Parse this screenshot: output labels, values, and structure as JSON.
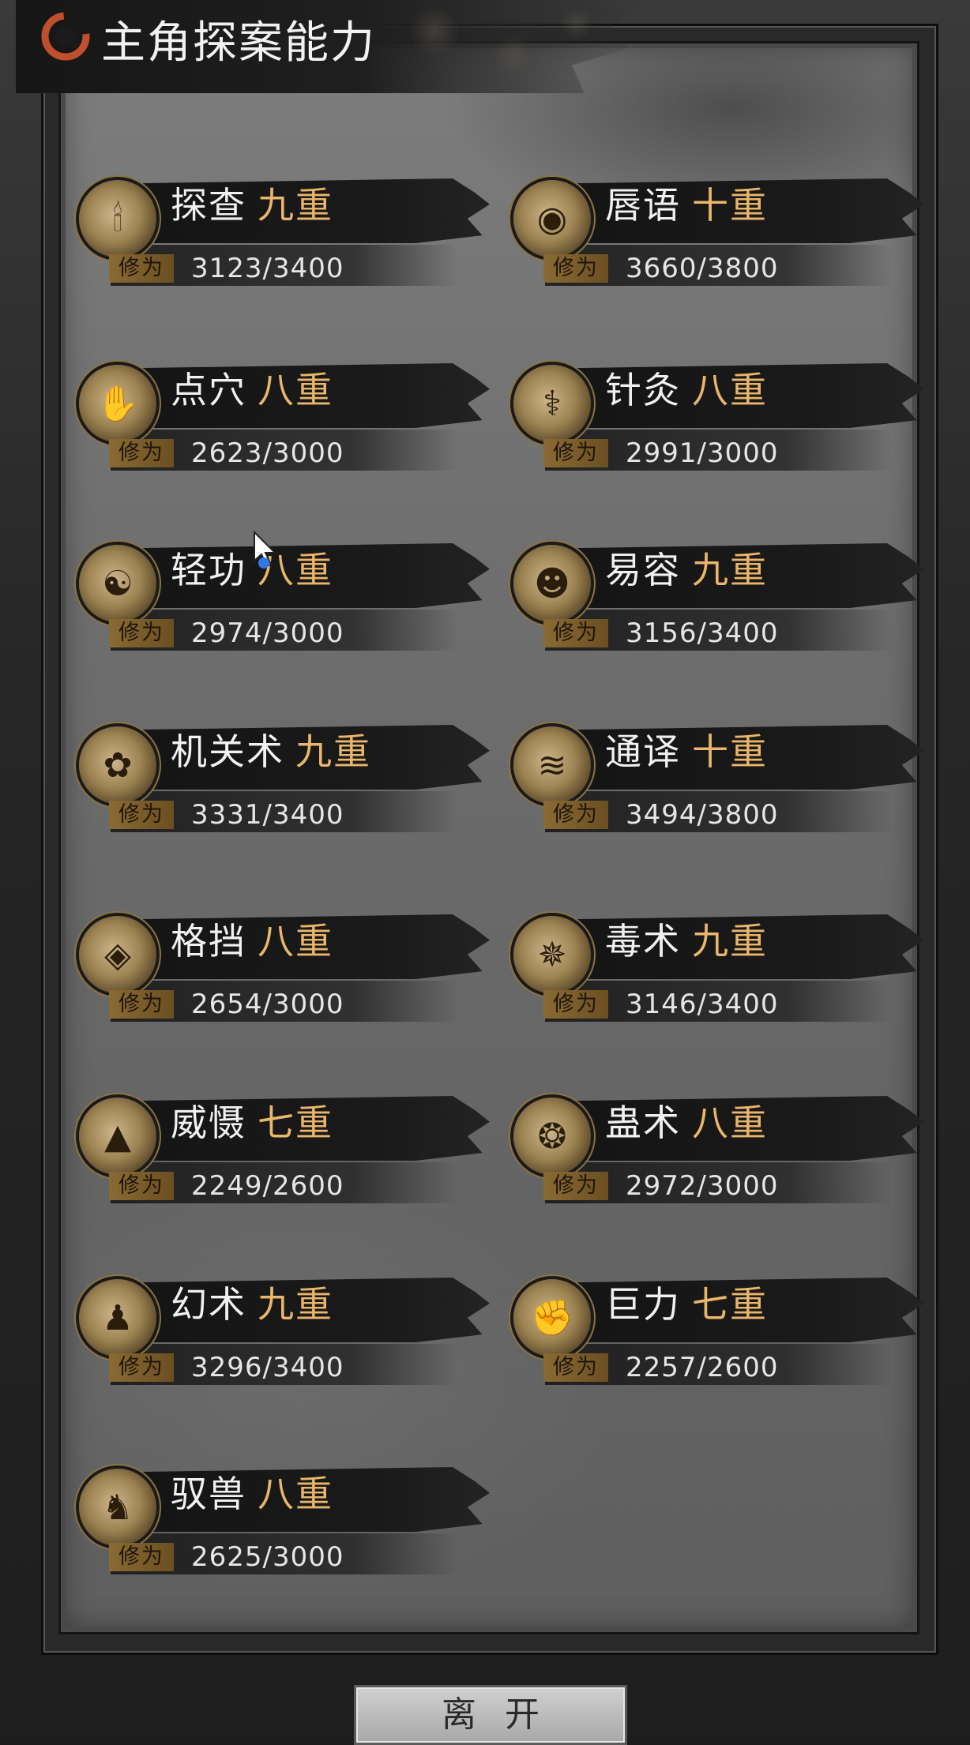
{
  "header": {
    "title": "主角探案能力"
  },
  "xp_label": "修为",
  "skills": [
    {
      "name": "探查",
      "rank": "九重",
      "xp": "3123/3400",
      "icon": "candle-icon"
    },
    {
      "name": "唇语",
      "rank": "十重",
      "xp": "3660/3800",
      "icon": "lips-icon"
    },
    {
      "name": "点穴",
      "rank": "八重",
      "xp": "2623/3000",
      "icon": "hand-icon"
    },
    {
      "name": "针灸",
      "rank": "八重",
      "xp": "2991/3000",
      "icon": "needle-icon"
    },
    {
      "name": "轻功",
      "rank": "八重",
      "xp": "2974/3000",
      "icon": "flying-figure-icon"
    },
    {
      "name": "易容",
      "rank": "九重",
      "xp": "3156/3400",
      "icon": "mask-icon"
    },
    {
      "name": "机关术",
      "rank": "九重",
      "xp": "3331/3400",
      "icon": "gear-icon"
    },
    {
      "name": "通译",
      "rank": "十重",
      "xp": "3494/3800",
      "icon": "scroll-icon"
    },
    {
      "name": "格挡",
      "rank": "八重",
      "xp": "2654/3000",
      "icon": "shield-icon"
    },
    {
      "name": "毒术",
      "rank": "九重",
      "xp": "3146/3400",
      "icon": "spider-icon"
    },
    {
      "name": "威慑",
      "rank": "七重",
      "xp": "2249/2600",
      "icon": "guardian-icon"
    },
    {
      "name": "蛊术",
      "rank": "八重",
      "xp": "2972/3000",
      "icon": "insect-icon"
    },
    {
      "name": "幻术",
      "rank": "九重",
      "xp": "3296/3400",
      "icon": "hooded-figure-icon"
    },
    {
      "name": "巨力",
      "rank": "七重",
      "xp": "2257/2600",
      "icon": "fist-icon"
    },
    {
      "name": "驭兽",
      "rank": "八重",
      "xp": "2625/3000",
      "icon": "beast-icon"
    }
  ],
  "footer": {
    "leave_label": "离开"
  }
}
